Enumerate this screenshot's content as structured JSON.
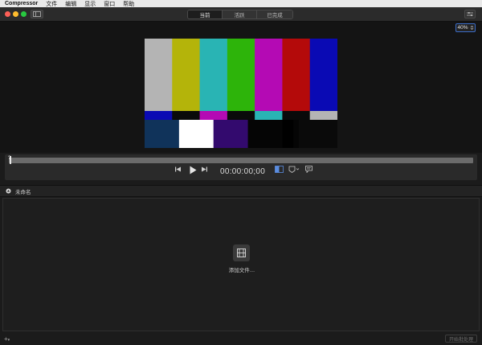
{
  "menubar": {
    "app_name": "Compressor",
    "items": [
      "文件",
      "编辑",
      "显示",
      "窗口",
      "帮助"
    ]
  },
  "toolbar": {
    "tabs": [
      {
        "label": "当前",
        "active": true
      },
      {
        "label": "活跃",
        "active": false
      },
      {
        "label": "已完成",
        "active": false
      }
    ]
  },
  "viewer": {
    "zoom": "40%",
    "color_bars": {
      "top": [
        "#b4b4b4",
        "#b4b40a",
        "#29b4b4",
        "#2db40a",
        "#b40ab4",
        "#b40a0a",
        "#0a0ab4"
      ],
      "middle": [
        "#0a0ab4",
        "#0a0a0a",
        "#b40ab4",
        "#0a0a0a",
        "#29b4b4",
        "#0a0a0a",
        "#b4b4b4"
      ],
      "bottom": [
        "#10335a",
        "#ffffff",
        "#330a6e",
        "#050505",
        "#000000",
        "#050505",
        "#0a0a0a"
      ]
    }
  },
  "playback": {
    "playhead_marker": "?",
    "timecode": "00:00:00;00"
  },
  "batch": {
    "title": "未命名",
    "add_files_label": "添加文件…"
  },
  "footer": {
    "add_label": "+",
    "start_batch_label": "开始批处理"
  }
}
